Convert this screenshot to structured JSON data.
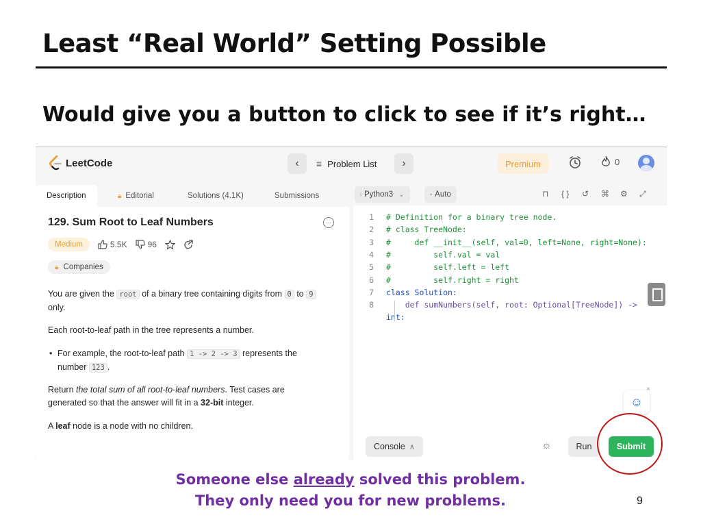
{
  "slide": {
    "title": "Least “Real World” Setting Possible",
    "subtitle": "Would give you a button to click to see if it’s right…",
    "caption_line1_pre": "Someone else ",
    "caption_line1_em": "already",
    "caption_line1_post": " solved this problem.",
    "caption_line2": "They only need you for new problems.",
    "page_number": "9",
    "caption_color": "#7030a0",
    "highlight_circle_color": "#c01818"
  },
  "leetcode": {
    "logo_text": "LeetCode",
    "nav": {
      "prev_icon": "chevron-left-icon",
      "problem_list_label": "Problem List",
      "next_icon": "chevron-right-icon",
      "premium_label": "Premium",
      "streak_count": "0"
    },
    "tabs": [
      {
        "label": "Description"
      },
      {
        "label": "Editorial"
      },
      {
        "label": "Solutions (4.1K)"
      },
      {
        "label": "Submissions"
      }
    ],
    "problem": {
      "title": "129. Sum Root to Leaf Numbers",
      "difficulty": "Medium",
      "likes": "5.5K",
      "dislikes": "96",
      "companies_label": "Companies"
    },
    "description": {
      "p1_a": "You are given the ",
      "p1_code1": "root",
      "p1_b": " of a binary tree containing digits from ",
      "p1_code2": "0",
      "p1_c": " to ",
      "p1_code3": "9",
      "p1_d": "only.",
      "p2": "Each root-to-leaf path in the tree represents a number.",
      "bullet_a": "For example, the root-to-leaf path ",
      "bullet_code": "1 -> 2 -> 3",
      "bullet_b": " represents the",
      "bullet_c": "number ",
      "bullet_code2": "123",
      "bullet_d": ".",
      "p3_a": "Return ",
      "p3_em": "the total sum of all root-to-leaf numbers",
      "p3_b": ". Test cases are",
      "p3_c": "generated so that the answer will fit in a ",
      "p3_strong": "32-bit",
      "p3_d": " integer.",
      "p4_a": "A ",
      "p4_strong": "leaf",
      "p4_b": " node is a node with no children."
    },
    "editor": {
      "language": "Python3",
      "mode": "Auto",
      "console_label": "Console",
      "run_label": "Run",
      "submit_label": "Submit",
      "submit_color": "#2db55d",
      "code_lines": [
        "# Definition for a binary tree node.",
        "# class TreeNode:",
        "#     def __init__(self, val=0, left=None, right=None):",
        "#         self.val = val",
        "#         self.left = left",
        "#         self.right = right",
        "class Solution:",
        "    def sumNumbers(self, root: Optional[TreeNode]) ->",
        "int:"
      ],
      "line_numbers": [
        "1",
        "2",
        "3",
        "4",
        "5",
        "6",
        "7",
        "8"
      ]
    }
  }
}
